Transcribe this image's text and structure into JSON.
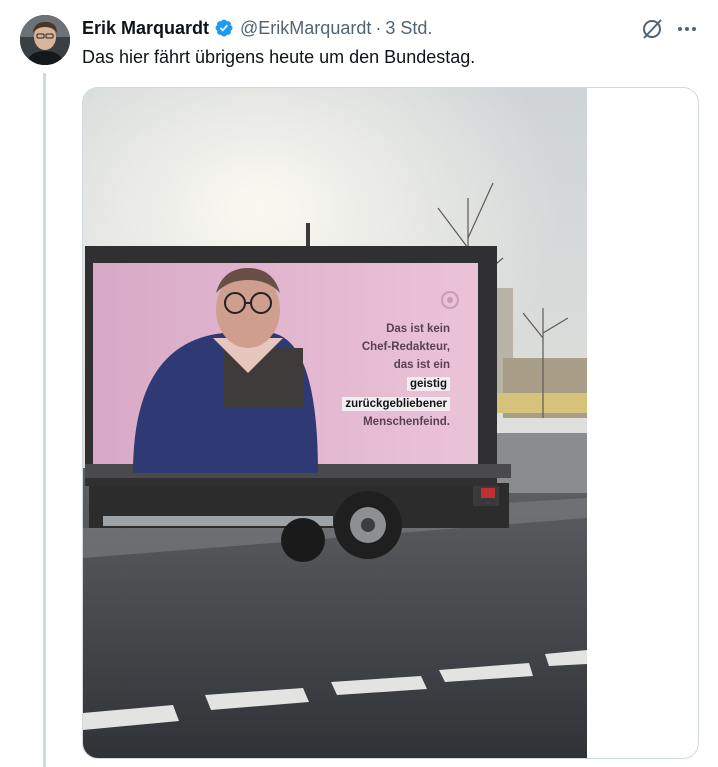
{
  "tweet": {
    "author_name": "Erik Marquardt",
    "handle": "@ErikMarquardt",
    "separator": "·",
    "time": "3 Std.",
    "verified": true,
    "text": "Das hier fährt übrigens heute um den Bundestag."
  },
  "icons": {
    "avatar": "profile-photo",
    "verified": "verified-badge-icon",
    "grok": "grok-icon",
    "more": "more-icon"
  },
  "media": {
    "type": "photo",
    "billboard_text": {
      "line1": "Das ist kein",
      "line2": "Chef-Redakteur,",
      "line3": "das ist ein",
      "highlight1": "geistig",
      "highlight2": "zurückgebliebener",
      "line4": "Menschenfeind."
    }
  },
  "colors": {
    "accent": "#1d9bf0",
    "text_secondary": "#536471",
    "border": "#cfd9de"
  }
}
